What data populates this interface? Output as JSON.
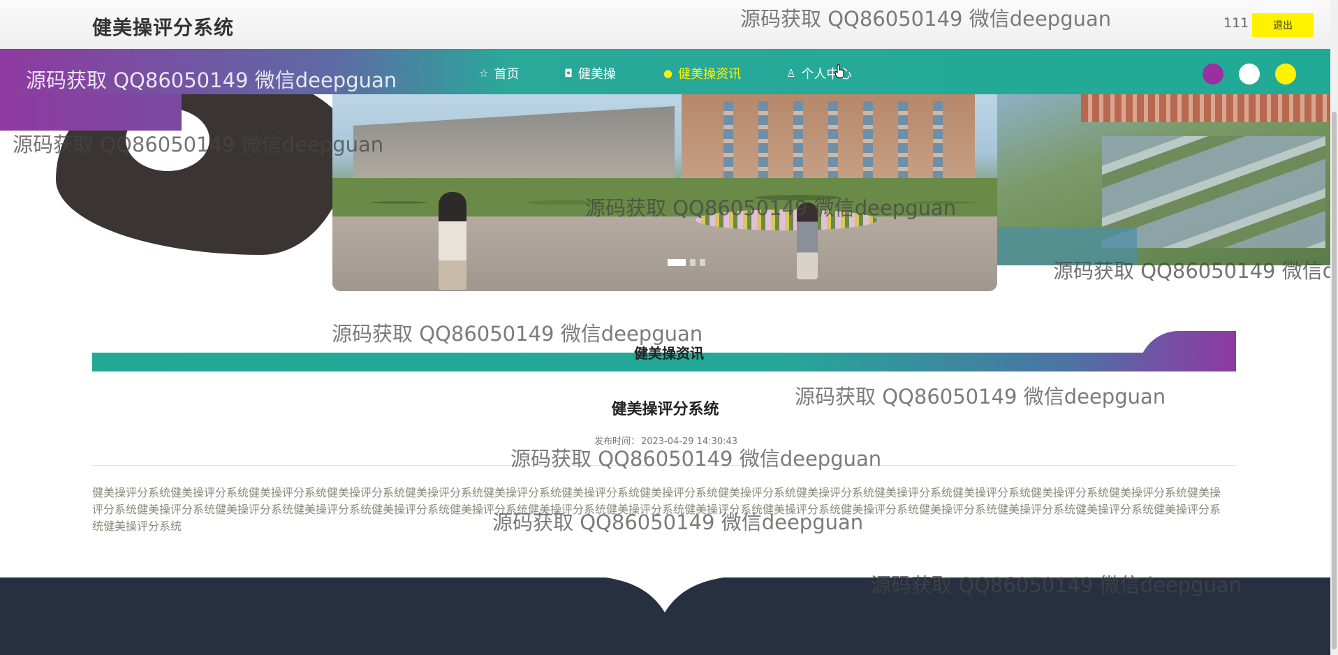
{
  "header": {
    "site_title": "健美操评分系统",
    "username": "111",
    "logout_label": "退出"
  },
  "nav": {
    "items": [
      {
        "icon": "☆",
        "label": "首页"
      },
      {
        "icon": "◘",
        "label": "健美操"
      },
      {
        "icon": "●",
        "label": "健美操资讯"
      },
      {
        "icon": "♙",
        "label": "个人中心"
      }
    ],
    "active_index": 2
  },
  "theme_swatches": [
    "#9b2fa0",
    "#ffffff",
    "#fff200"
  ],
  "carousel": {
    "slide_count": 3,
    "active_index": 0
  },
  "section": {
    "title": "健美操资讯"
  },
  "article": {
    "title": "健美操评分系统",
    "meta_label": "发布时间：",
    "publish_time": "2023-04-29 14:30:43",
    "body": "健美操评分系统健美操评分系统健美操评分系统健美操评分系统健美操评分系统健美操评分系统健美操评分系统健美操评分系统健美操评分系统健美操评分系统健美操评分系统健美操评分系统健美操评分系统健美操评分系统健美操评分系统健美操评分系统健美操评分系统健美操评分系统健美操评分系统健美操评分系统健美操评分系统健美操评分系统健美操评分系统健美操评分系统健美操评分系统健美操评分系统健美操评分系统健美操评分系统健美操评分系统健美操评分系统"
  },
  "watermark": {
    "text": "源码获取 QQ86050149 微信deepguan"
  },
  "colors": {
    "accent_teal": "#20aa96",
    "accent_purple": "#8e3aa0",
    "accent_yellow": "#fff200",
    "footer": "#263040"
  }
}
